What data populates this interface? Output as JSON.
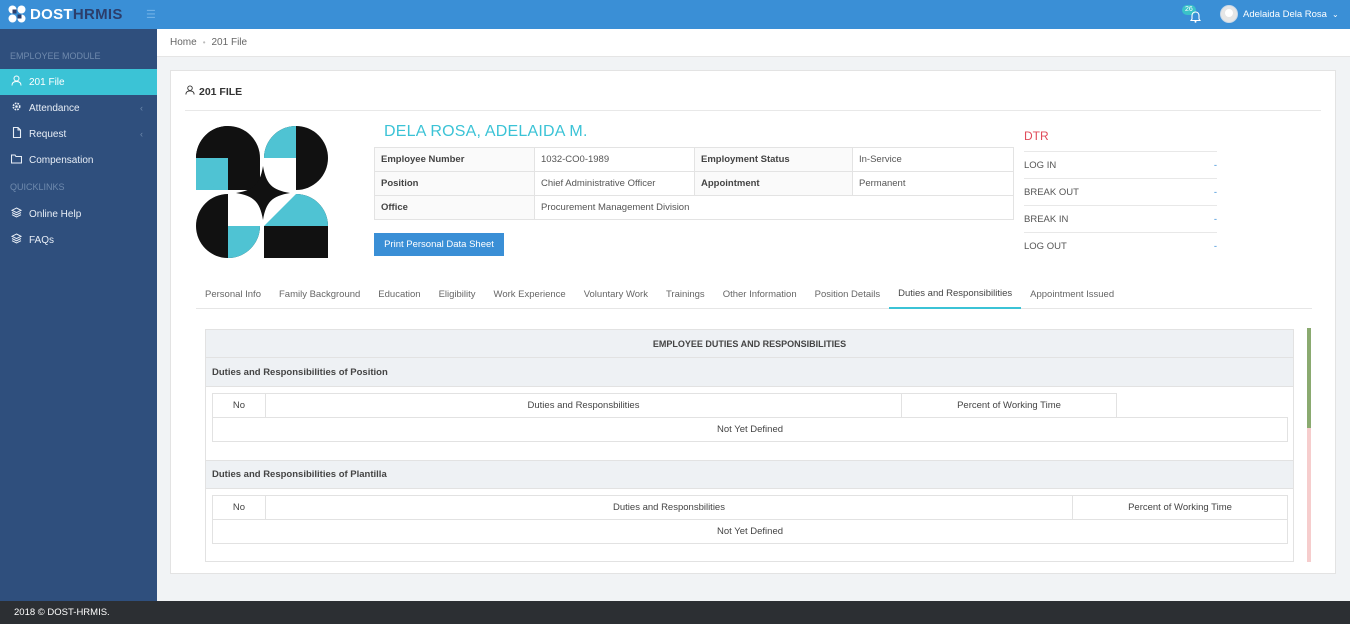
{
  "app": {
    "brand_part1": "DOST",
    "brand_part2": "HRMIS"
  },
  "header": {
    "notification_count": "26",
    "user_name": "Adelaida Dela Rosa"
  },
  "sidebar": {
    "section_employee": "EMPLOYEE MODULE",
    "items": [
      {
        "label": "201 File",
        "icon": "user-icon"
      },
      {
        "label": "Attendance",
        "icon": "gear-icon"
      },
      {
        "label": "Request",
        "icon": "document-icon"
      },
      {
        "label": "Compensation",
        "icon": "folder-icon"
      }
    ],
    "section_quicklinks": "QUICKLINKS",
    "quicklinks": [
      {
        "label": "Online Help",
        "icon": "layers-icon"
      },
      {
        "label": "FAQs",
        "icon": "layers-icon"
      }
    ]
  },
  "breadcrumb": {
    "home": "Home",
    "current": "201 File"
  },
  "page": {
    "title": "201 FILE"
  },
  "employee": {
    "name": "DELA ROSA, ADELAIDA M.",
    "fields": {
      "employee_number_label": "Employee Number",
      "employee_number": "1032-CO0-1989",
      "employment_status_label": "Employment Status",
      "employment_status": "In-Service",
      "position_label": "Position",
      "position": "Chief Administrative Officer",
      "appointment_label": "Appointment",
      "appointment": "Permanent",
      "office_label": "Office",
      "office": "Procurement Management Division"
    },
    "print_button": "Print Personal Data Sheet"
  },
  "dtr": {
    "title": "DTR",
    "rows": [
      {
        "label": "LOG IN",
        "value": "-"
      },
      {
        "label": "BREAK OUT",
        "value": "-"
      },
      {
        "label": "BREAK IN",
        "value": "-"
      },
      {
        "label": "LOG OUT",
        "value": "-"
      }
    ]
  },
  "tabs": [
    "Personal Info",
    "Family Background",
    "Education",
    "Eligibility",
    "Work Experience",
    "Voluntary Work",
    "Trainings",
    "Other Information",
    "Position Details",
    "Duties and Responsibilities",
    "Appointment Issued"
  ],
  "duties": {
    "panel_title": "EMPLOYEE DUTIES AND RESPONSIBILITIES",
    "position_section": "Duties and Responsibilities of Position",
    "plantilla_section": "Duties and Responsibilities of Plantilla",
    "col_no": "No",
    "col_duties": "Duties and Responsbilities",
    "col_percent": "Percent of Working Time",
    "empty_text": "Not Yet Defined"
  },
  "footer": {
    "text": "2018 © DOST-HRMIS."
  },
  "colors": {
    "topbar": "#3a8fd6",
    "sidebar": "#2f4f7d",
    "accent": "#3bc3d6",
    "dtr": "#e04b5a"
  }
}
